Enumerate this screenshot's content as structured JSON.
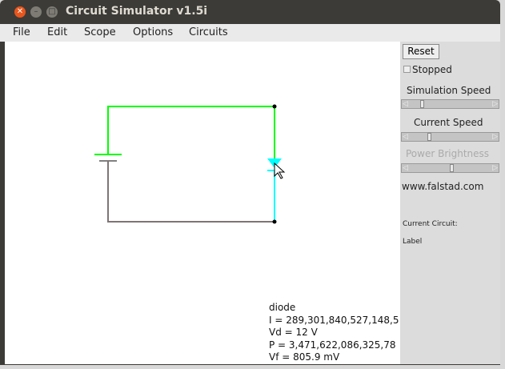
{
  "window": {
    "title": "Circuit Simulator v1.5i"
  },
  "menu": [
    "File",
    "Edit",
    "Scope",
    "Options",
    "Circuits"
  ],
  "panel": {
    "reset": "Reset",
    "stopped": "Stopped",
    "sim_speed": "Simulation Speed",
    "current_speed": "Current Speed",
    "power_brightness": "Power Brightness",
    "url": "www.falstad.com",
    "current_circuit": "Current Circuit:",
    "label": "Label",
    "sliders": {
      "simulation_speed": 0.1,
      "current_speed": 0.18,
      "power_brightness": 0.5
    }
  },
  "info": [
    "diode",
    "I = 289,301,840,527,148,5",
    "Vd = 12 V",
    "P = 3,471,622,086,325,78",
    "Vf = 805.9 mV"
  ],
  "colors": {
    "wire_high": "#00ff00",
    "wire_low": "#808080",
    "diode": "#00ffff"
  }
}
